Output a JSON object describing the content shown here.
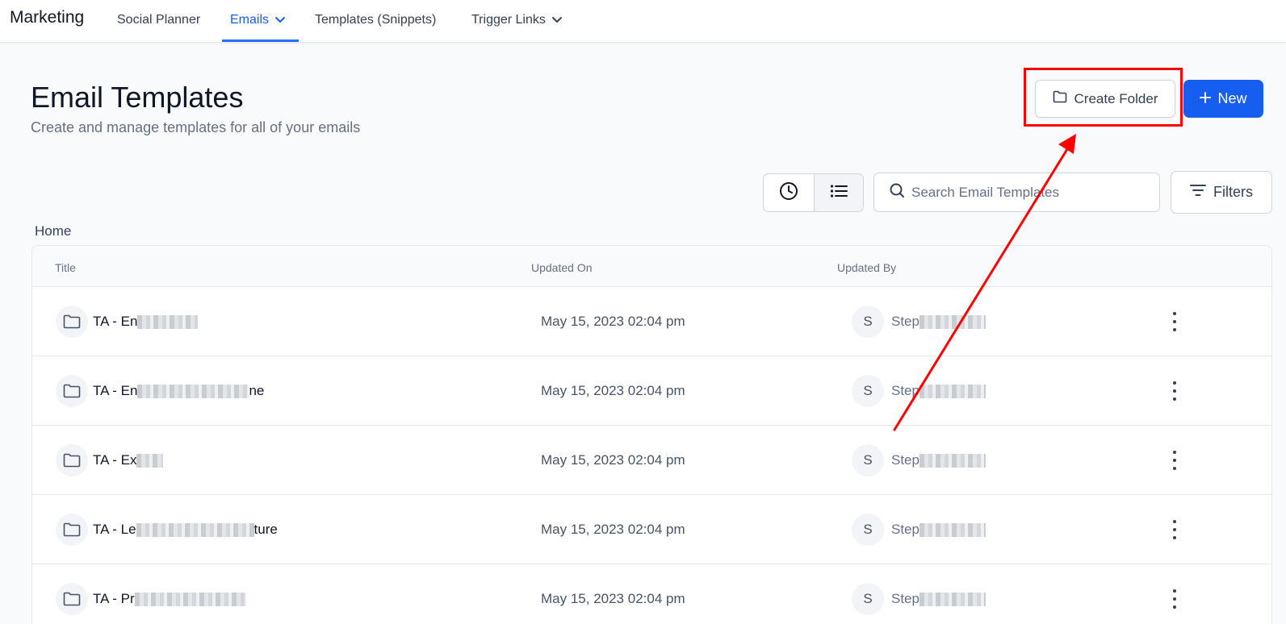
{
  "nav": {
    "brand": "Marketing",
    "items": [
      {
        "label": "Social Planner"
      },
      {
        "label": "Emails"
      },
      {
        "label": "Templates (Snippets)"
      },
      {
        "label": "Trigger Links"
      }
    ],
    "active_index": 1
  },
  "header": {
    "title": "Email Templates",
    "subtitle": "Create and manage templates for all of your emails",
    "create_folder_label": "Create Folder",
    "new_label": "New"
  },
  "toolbar": {
    "search_placeholder": "Search Email Templates",
    "filters_label": "Filters"
  },
  "breadcrumb": "Home",
  "table": {
    "columns": [
      "Title",
      "Updated On",
      "Updated By"
    ],
    "rows": [
      {
        "title": "TA - En",
        "title_suffix": "",
        "updated_on": "May 15, 2023 02:04 pm",
        "avatar": "S",
        "updated_by": "Step"
      },
      {
        "title": "TA - En",
        "title_suffix": "ne",
        "updated_on": "May 15, 2023 02:04 pm",
        "avatar": "S",
        "updated_by": "Step"
      },
      {
        "title": "TA - Ex",
        "title_suffix": "",
        "updated_on": "May 15, 2023 02:04 pm",
        "avatar": "S",
        "updated_by": "Step"
      },
      {
        "title": "TA - Le",
        "title_suffix": "ture",
        "updated_on": "May 15, 2023 02:04 pm",
        "avatar": "S",
        "updated_by": "Step"
      },
      {
        "title": "TA - Pr",
        "title_suffix": "",
        "updated_on": "May 15, 2023 02:04 pm",
        "avatar": "S",
        "updated_by": "Step"
      }
    ]
  },
  "colors": {
    "primary": "#155eef",
    "annotation": "#ff0000"
  }
}
